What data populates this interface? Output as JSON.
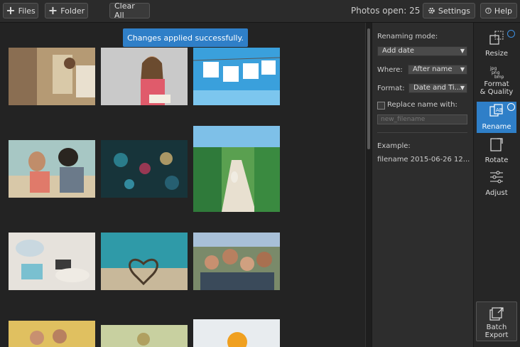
{
  "toolbar": {
    "files_label": "Files",
    "folder_label": "Folder",
    "clear_label": "Clear All",
    "photos_open": "Photos open: 25",
    "settings_label": "Settings",
    "help_label": "Help"
  },
  "toast": "Changes applied successfully.",
  "panel": {
    "renaming_mode_label": "Renaming mode:",
    "renaming_mode_value": "Add date",
    "where_label": "Where:",
    "where_value": "After name",
    "format_label": "Format:",
    "format_value": "Date and Ti...",
    "replace_label": "Replace name with:",
    "replace_placeholder": "new_filename",
    "example_label": "Example:",
    "example_value": "filename 2015-06-26 12..."
  },
  "tools": {
    "resize": "Resize",
    "format_l1": "Format",
    "format_l2": "& Quality",
    "rename": "Rename",
    "rotate": "Rotate",
    "adjust": "Adjust",
    "batch_l1": "Batch",
    "batch_l2": "Export"
  },
  "icons": [
    "plus-icon",
    "gear-icon",
    "help-icon",
    "resize-icon",
    "format-icon",
    "rename-icon",
    "rotate-icon",
    "adjust-icon",
    "batch-export-icon",
    "checkmark-badge-icon"
  ],
  "colors": {
    "accent": "#2f7fc8",
    "background": "#232323",
    "panel": "#2d2d2d"
  }
}
